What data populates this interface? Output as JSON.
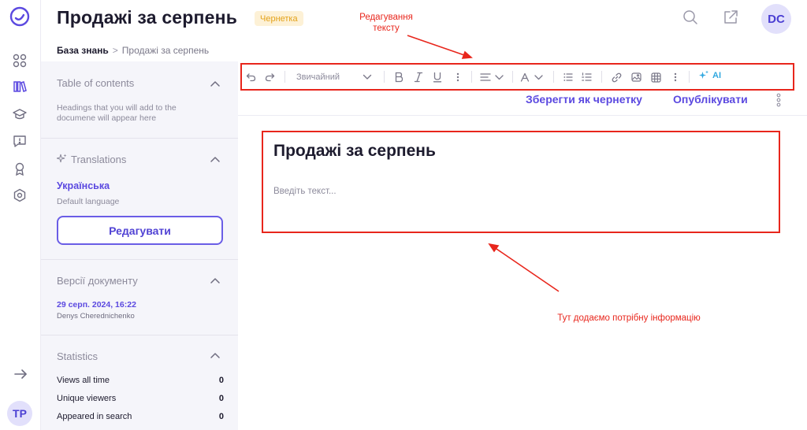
{
  "header": {
    "title": "Продажі за серпень",
    "status_badge": "Чернетка",
    "avatar_initials": "DC"
  },
  "breadcrumb": {
    "root": "База знань",
    "separator": ">",
    "current": "Продажі за серпень"
  },
  "rail": {
    "items": [
      "apps-icon",
      "library-icon",
      "graduation-cap-icon",
      "feedback-icon",
      "award-icon",
      "settings-hexagon-icon"
    ],
    "user_initials": "TP"
  },
  "sidebar": {
    "toc": {
      "title": "Table of contents",
      "empty_hint": "Headings that you will add to the documene will appear here"
    },
    "translations": {
      "title": "Translations",
      "language": "Українська",
      "language_note": "Default language",
      "edit_button": "Редагувати"
    },
    "versions": {
      "title": "Версії документу",
      "date": "29 серп. 2024, 16:22",
      "author": "Denys Cherednichenko"
    },
    "statistics": {
      "title": "Statistics",
      "rows": [
        {
          "label": "Views all time",
          "value": "0"
        },
        {
          "label": "Unique viewers",
          "value": "0"
        },
        {
          "label": "Appeared in search",
          "value": "0"
        }
      ]
    }
  },
  "toolbar": {
    "text_style": "Звичайний",
    "ai_label": "AI"
  },
  "actions": {
    "save_draft": "Зберегти як чернетку",
    "publish": "Опублікувати"
  },
  "document": {
    "title": "Продажі за серпень",
    "placeholder": "Введіть текст..."
  },
  "annotations": {
    "toolbar_note_line1": "Редагування",
    "toolbar_note_line2": "тексту",
    "content_note": "Тут додаємо потрібну інформацію",
    "color": "#e8261c"
  },
  "colors": {
    "accent": "#5b49e0",
    "draft_badge_bg": "#fdf1d6",
    "draft_badge_text": "#e3a21a",
    "sidebar_bg": "#f5f5fa",
    "ai": "#31a8e0"
  }
}
